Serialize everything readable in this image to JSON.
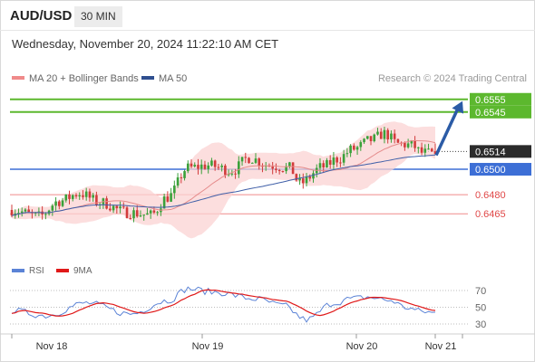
{
  "header": {
    "pair": "AUD/USD",
    "timeframe": "30 MIN"
  },
  "timestamp": "Wednesday, November 20, 2024 11:22:10 AM CET",
  "legend": {
    "ma20_label": "MA 20 + Bollinger Bands",
    "ma50_label": "MA 50"
  },
  "credit": "Research © 2024 Trading Central",
  "colors": {
    "resistance": "#5cb82e",
    "support_blue": "#3d6fd6",
    "support_red": "#f08a8a",
    "bull": "#3aa13a",
    "bear": "#d23b3b",
    "bollinger": "#fbd3d3",
    "ma20": "#e58b8b",
    "ma50": "#3f5fa8",
    "arrow": "#2b5ba6",
    "current": "#2b2b2b",
    "rsi": "#5b83d6",
    "rsi_ma": "#e01919"
  },
  "chart_data": [
    {
      "type": "candlestick",
      "x_ticks": [
        "Nov 18",
        "Nov 19",
        "Nov 20",
        "Nov 21"
      ],
      "ylim": [
        0.64445,
        0.65655
      ],
      "price_range": {
        "low": 0.6462,
        "high": 0.6532
      },
      "start_price": 0.6468,
      "candle_count": 126,
      "anchors": [
        [
          0,
          0.6468
        ],
        [
          8,
          0.6463
        ],
        [
          14,
          0.6475
        ],
        [
          20,
          0.6481
        ],
        [
          26,
          0.6474
        ],
        [
          34,
          0.6466
        ],
        [
          41,
          0.6464
        ],
        [
          46,
          0.6478
        ],
        [
          52,
          0.6501
        ],
        [
          58,
          0.6503
        ],
        [
          65,
          0.6499
        ],
        [
          70,
          0.6509
        ],
        [
          76,
          0.6503
        ],
        [
          82,
          0.6501
        ],
        [
          85,
          0.6489
        ],
        [
          92,
          0.6502
        ],
        [
          96,
          0.6508
        ],
        [
          101,
          0.6516
        ],
        [
          106,
          0.6523
        ],
        [
          110,
          0.6528
        ],
        [
          114,
          0.652
        ],
        [
          118,
          0.6519
        ],
        [
          121,
          0.6513
        ],
        [
          125,
          0.6512
        ]
      ],
      "levels": [
        {
          "value": 0.6555,
          "label": "0.6555",
          "kind": "resistance"
        },
        {
          "value": 0.6545,
          "label": "0.6545",
          "kind": "resistance"
        },
        {
          "value": 0.6514,
          "label": "0.6514",
          "kind": "current"
        },
        {
          "value": 0.65,
          "label": "0.6500",
          "kind": "pivot"
        },
        {
          "value": 0.648,
          "label": "0.6480",
          "kind": "support"
        },
        {
          "value": 0.6465,
          "label": "0.6465",
          "kind": "support"
        }
      ],
      "series": [
        {
          "name": "MA 20 + Bollinger Bands"
        },
        {
          "name": "MA 50"
        }
      ],
      "forecast_target": 0.6555
    },
    {
      "type": "line",
      "series": [
        {
          "name": "RSI"
        },
        {
          "name": "9MA"
        }
      ],
      "ylim": [
        20,
        80
      ],
      "y_ticks": [
        70,
        50,
        30
      ],
      "rsi_anchors": [
        [
          0,
          46
        ],
        [
          10,
          40
        ],
        [
          22,
          55
        ],
        [
          35,
          42
        ],
        [
          46,
          58
        ],
        [
          52,
          72
        ],
        [
          60,
          68
        ],
        [
          72,
          60
        ],
        [
          80,
          52
        ],
        [
          87,
          35
        ],
        [
          95,
          55
        ],
        [
          100,
          60
        ],
        [
          105,
          62
        ],
        [
          112,
          58
        ],
        [
          116,
          50
        ],
        [
          121,
          45
        ],
        [
          125,
          43
        ]
      ]
    }
  ]
}
